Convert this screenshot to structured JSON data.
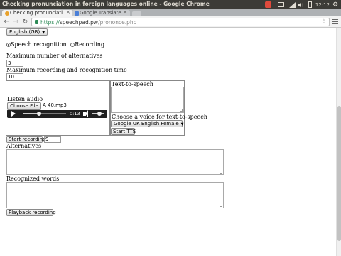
{
  "window": {
    "title": "Checking pronunciation in foreign languages online - Google Chrome"
  },
  "tray": {
    "time": "12:12"
  },
  "tabs": [
    {
      "label": "Checking pronunciati",
      "active": true
    },
    {
      "label": "Google Translate",
      "active": false
    }
  ],
  "omnibox": {
    "scheme": "https://",
    "host": "speechpad.pw",
    "path": "/prononce.php"
  },
  "page": {
    "language_select": "English (GB)",
    "mode_options": [
      "Speech recognition",
      "Recording"
    ],
    "mode_selected": "Speech recognition",
    "max_alternatives_label": "Maximum number of alternatives",
    "max_alternatives_value": "3",
    "max_time_label": "Maximum recording and recognition time",
    "max_time_value": "10",
    "listen_audio_label": "Listen audio",
    "choose_file_label": "Choose File",
    "file_name": "A 40.mp3",
    "player_time": "0:13",
    "player_progress": 0.37,
    "volume_level": 0.6,
    "tts_label": "Text-to-speech",
    "tts_text": "",
    "voice_label": "Choose a voice for text-to-speech",
    "voice_select": "Google UK English Female",
    "start_tts_label": "Start TTS",
    "start_recording_label": "Start recording",
    "start_recording_value": "9",
    "alternatives_label": "Alternatives",
    "alternatives_text": "",
    "recognized_words_label": "Recognized words",
    "recognized_words_text": "",
    "playback_label": "Playback recording"
  },
  "colors": {
    "titlebar": "#3c3b37",
    "tray_alert": "#e04a3c",
    "secure": "#2e8b57"
  },
  "icons": [
    "back-icon",
    "forward-icon",
    "reload-icon",
    "lock-icon",
    "star-icon",
    "menu-icon",
    "play-icon",
    "speaker-icon",
    "close-icon",
    "chevron-down-icon",
    "gear-icon",
    "mail-icon",
    "network-icon",
    "volume-icon",
    "battery-icon"
  ]
}
